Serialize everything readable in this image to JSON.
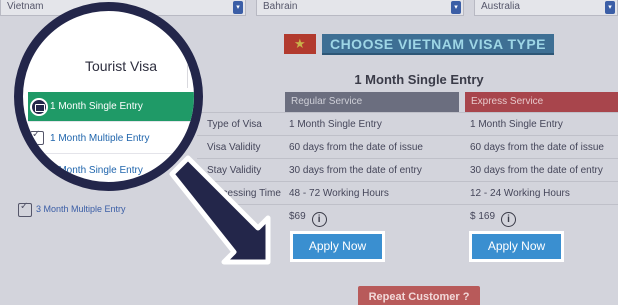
{
  "selects": {
    "first": "Vietnam",
    "second": "Bahrain",
    "third": "Australia"
  },
  "header": {
    "title": "CHOOSE VIETNAM VISA TYPE",
    "flag_icon": "vietnam-flag-icon"
  },
  "sidebar": {
    "title": "Tourist Visa",
    "items": [
      {
        "label": "1 Month Single Entry",
        "active": true
      },
      {
        "label": "1 Month Multiple Entry",
        "active": false
      },
      {
        "label": "3 Month Single Entry",
        "active": false
      },
      {
        "label": "3 Month Multiple Entry",
        "active": false
      }
    ]
  },
  "table": {
    "title": "1 Month Single Entry",
    "columns": [
      "Regular Service",
      "Express Service"
    ],
    "rows": [
      {
        "label": "Type of Visa",
        "regular": "1 Month Single Entry",
        "express": "1 Month Single Entry"
      },
      {
        "label": "Visa Validity",
        "regular": "60 days from the date of issue",
        "express": "60 days from the date of issue"
      },
      {
        "label": "Stay Validity",
        "regular": "30 days from the date of entry",
        "express": "30 days from the date of entry"
      },
      {
        "label": "Processing Time",
        "regular": "48 - 72 Working Hours",
        "express": "12 - 24 Working Hours"
      },
      {
        "label": "",
        "regular": "$69",
        "express": "$ 169"
      }
    ]
  },
  "buttons": {
    "apply_regular": "Apply Now",
    "apply_express": "Apply Now",
    "repeat_customer": "Repeat Customer ?"
  },
  "colors": {
    "active_item": "#1f9a67",
    "magnifier_ring": "#23264a",
    "apply_button": "#3a8fd0",
    "express_header": "#a8454c"
  }
}
